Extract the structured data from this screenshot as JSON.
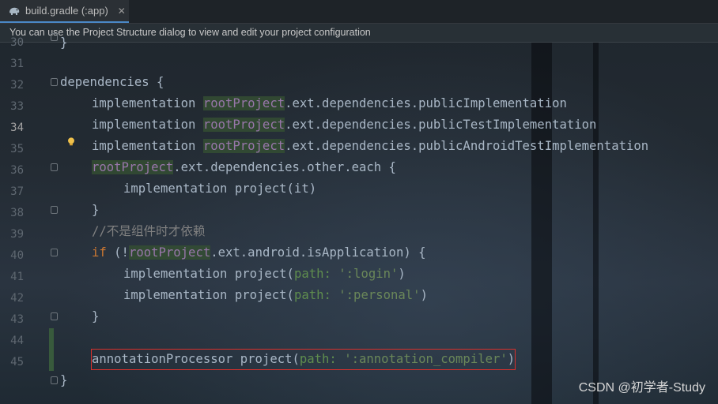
{
  "tab": {
    "title": "build.gradle (:app)",
    "close_glyph": "✕",
    "icon": "gradle-elephant-icon"
  },
  "banner": {
    "text": "You can use the Project Structure dialog to view and edit your project configuration"
  },
  "gutter": {
    "line_numbers": [
      "30",
      "31",
      "32",
      "33",
      "34",
      "35",
      "36",
      "37",
      "38",
      "39",
      "40",
      "41",
      "42",
      "43",
      "44",
      "45"
    ],
    "active_line": "34"
  },
  "code": {
    "l30": "}",
    "l31": "dependencies {",
    "impl": "implementation",
    "root": "rootProject",
    "l32_rest": ".ext.dependencies.publicImplementation",
    "l33_rest": ".ext.dependencies.publicTestImplementation",
    "l34_rest": ".ext.dependencies.publicAndroidTestImplementation",
    "l35_rest": ".ext.dependencies.other.each {",
    "l36": "implementation project(it)",
    "close": "}",
    "l38_comment": "//不是组件时才依赖",
    "if_kw": "if",
    "l39_pre": " (!",
    "l39_rest": ".ext.android.isApplication) {",
    "l40_pre": "implementation project(",
    "path_tag": "path:",
    "l40_str": "':login'",
    "l41_str": "':personal'",
    "paren_close": ")",
    "l44_pre": "annotationProcessor project(",
    "l44_str": "':annotation_compiler'"
  },
  "watermark": "CSDN @初学者-Study"
}
